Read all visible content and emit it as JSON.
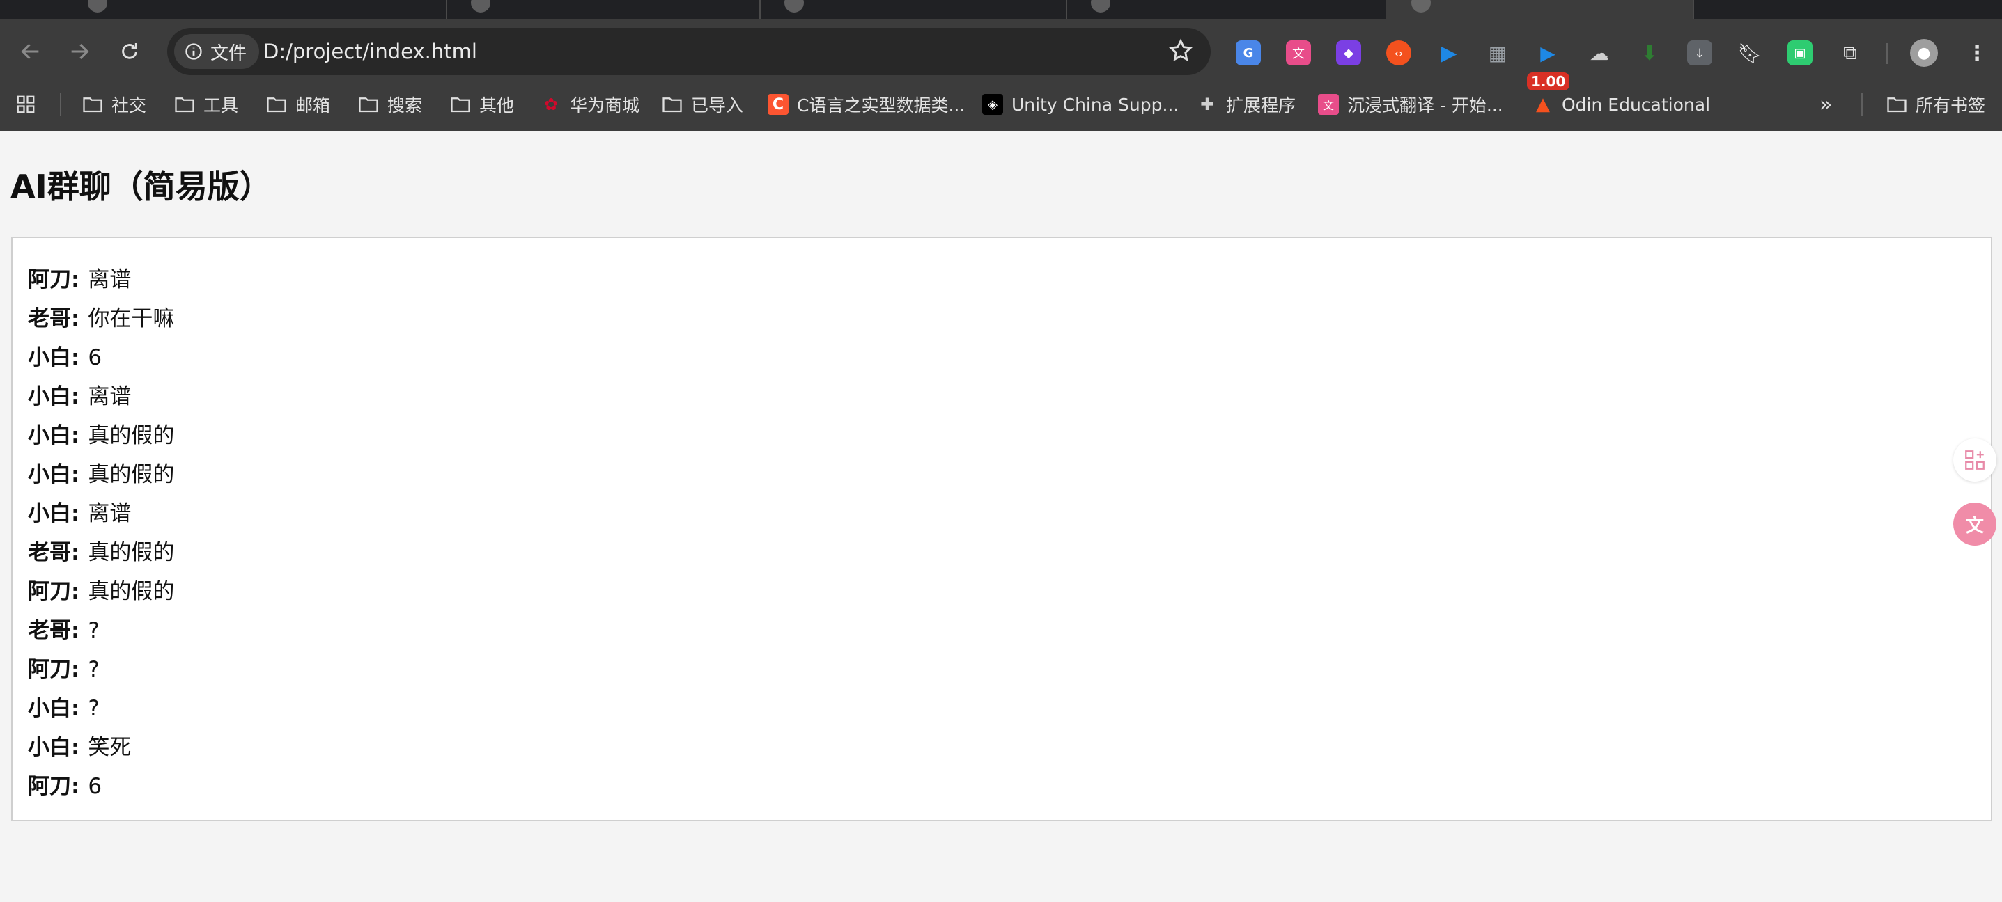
{
  "browser": {
    "site_info_label": "文件",
    "url": "D:/project/index.html",
    "extension_badge": "1.00",
    "bookmarks": [
      {
        "label": "社交",
        "icon": "folder-icon"
      },
      {
        "label": "工具",
        "icon": "folder-icon"
      },
      {
        "label": "邮箱",
        "icon": "folder-icon"
      },
      {
        "label": "搜索",
        "icon": "folder-icon"
      },
      {
        "label": "其他",
        "icon": "folder-icon"
      },
      {
        "label": "华为商城",
        "icon": "huawei-logo-icon"
      },
      {
        "label": "已导入",
        "icon": "folder-icon"
      },
      {
        "label": "C语言之实型数据类...",
        "icon": "csdn-logo-icon"
      },
      {
        "label": "Unity China Supp...",
        "icon": "unity-logo-icon"
      },
      {
        "label": "扩展程序",
        "icon": "puzzle-icon"
      },
      {
        "label": "沉浸式翻译 - 开始...",
        "icon": "immersive-translate-icon"
      },
      {
        "label": "Odin Educational",
        "icon": "odin-logo-icon"
      }
    ],
    "all_bookmarks_label": "所有书签"
  },
  "page": {
    "title": "AI群聊（简易版）",
    "messages": [
      {
        "sender": "阿刀:",
        "text": "离谱"
      },
      {
        "sender": "老哥:",
        "text": "你在干嘛"
      },
      {
        "sender": "小白:",
        "text": "6"
      },
      {
        "sender": "小白:",
        "text": "离谱"
      },
      {
        "sender": "小白:",
        "text": "真的假的"
      },
      {
        "sender": "小白:",
        "text": "真的假的"
      },
      {
        "sender": "小白:",
        "text": "离谱"
      },
      {
        "sender": "老哥:",
        "text": "真的假的"
      },
      {
        "sender": "阿刀:",
        "text": "真的假的"
      },
      {
        "sender": "老哥:",
        "text": "?"
      },
      {
        "sender": "阿刀:",
        "text": "?"
      },
      {
        "sender": "小白:",
        "text": "?"
      },
      {
        "sender": "小白:",
        "text": "笑死"
      },
      {
        "sender": "阿刀:",
        "text": "6"
      }
    ]
  },
  "colors": {
    "chrome_bg": "#3c3c3c",
    "page_bg": "#f4f4f4",
    "chat_border": "#cfcfcf",
    "badge": "#d93025"
  }
}
